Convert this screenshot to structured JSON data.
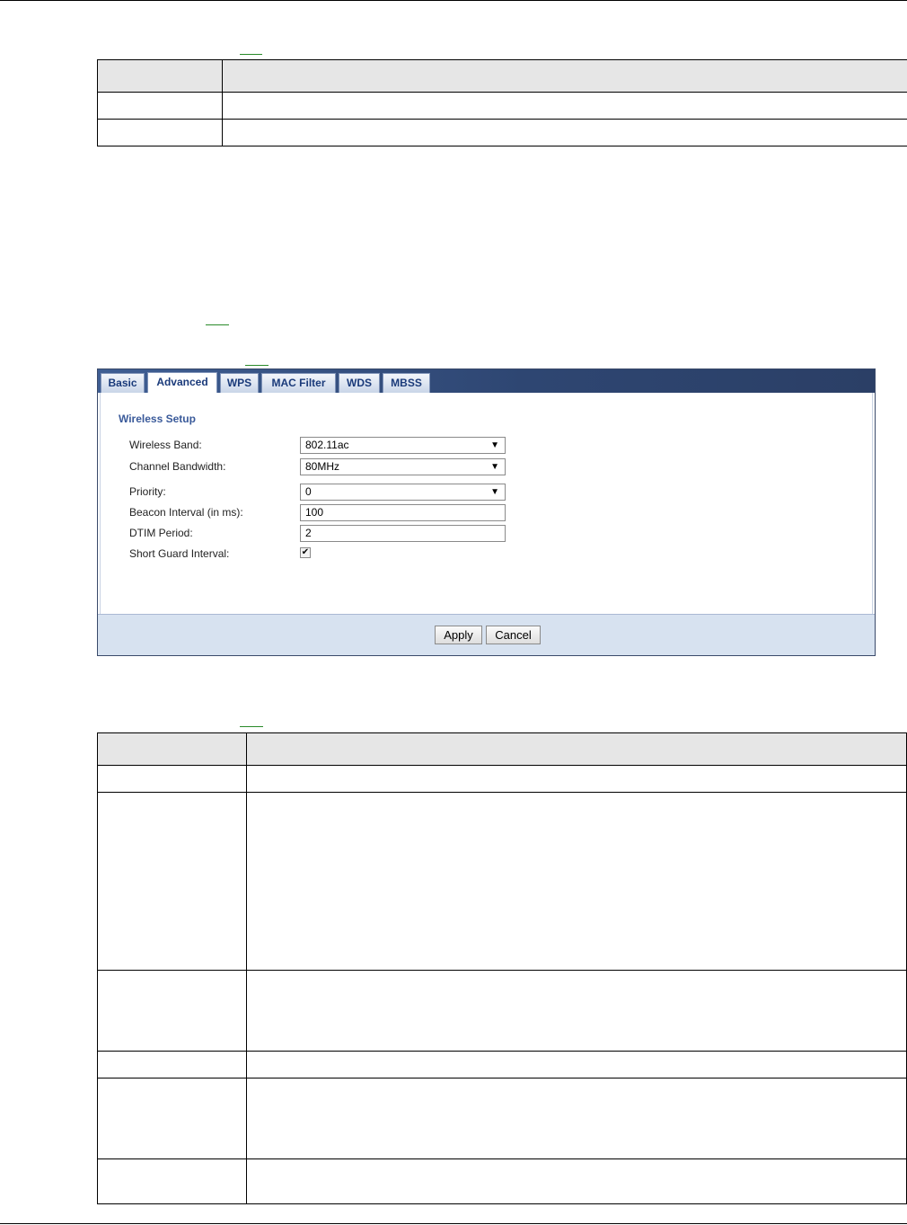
{
  "router_ui": {
    "tabs": [
      {
        "label": "Basic",
        "active": false
      },
      {
        "label": "Advanced",
        "active": true
      },
      {
        "label": "WPS",
        "active": false
      },
      {
        "label": "MAC Filter",
        "active": false
      },
      {
        "label": "WDS",
        "active": false
      },
      {
        "label": "MBSS",
        "active": false
      }
    ],
    "section_title": "Wireless Setup",
    "fields": {
      "wireless_band": {
        "label": "Wireless Band:",
        "value": "802.11ac"
      },
      "channel_bandwidth": {
        "label": "Channel Bandwidth:",
        "value": "80MHz"
      },
      "priority": {
        "label": "Priority:",
        "value": "0"
      },
      "beacon_interval": {
        "label": "Beacon Interval (in ms):",
        "value": "100"
      },
      "dtim_period": {
        "label": "DTIM Period:",
        "value": "2"
      },
      "short_guard_interval": {
        "label": "Short Guard Interval:",
        "checked": true
      }
    },
    "buttons": {
      "apply": "Apply",
      "cancel": "Cancel"
    },
    "caret_glyph": "▼",
    "check_glyph": "✔"
  },
  "colors": {
    "tab_text": "#1a3a7a",
    "section_title": "#3a5a9a",
    "footer_bar": "#d7e2f0",
    "table_header": "#e6e6e6",
    "link": "#2a8a2a"
  }
}
